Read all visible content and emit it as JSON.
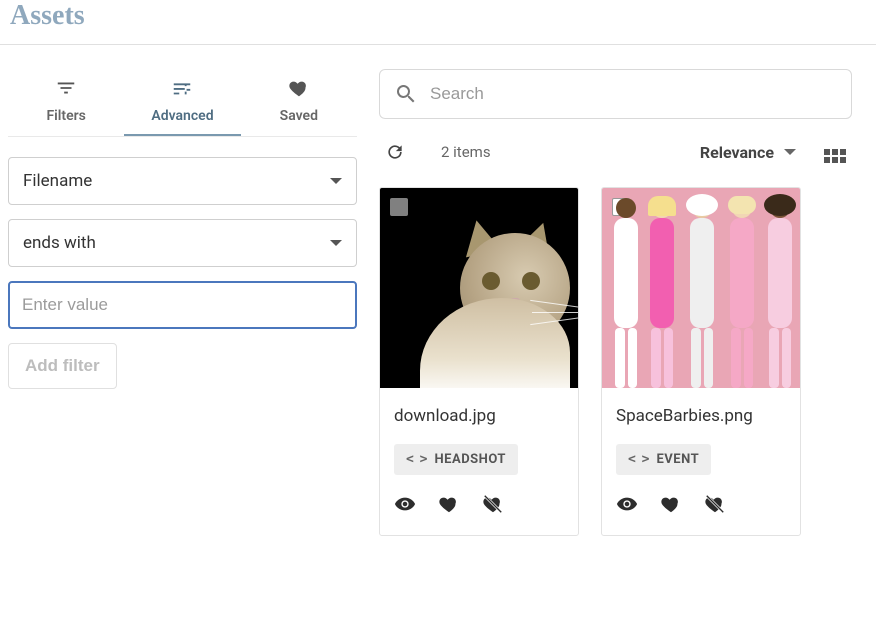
{
  "header": {
    "title": "Assets"
  },
  "tabs": {
    "filters": "Filters",
    "advanced": "Advanced",
    "saved": "Saved",
    "active": "advanced"
  },
  "filter_builder": {
    "field_select": "Filename",
    "operator_select": "ends with",
    "value_placeholder": "Enter value",
    "add_filter_label": "Add filter"
  },
  "search": {
    "placeholder": "Search"
  },
  "toolbar": {
    "count_text": "2 items",
    "sort_label": "Relevance"
  },
  "assets": [
    {
      "filename": "download.jpg",
      "tag": "HEADSHOT",
      "thumb": "cat"
    },
    {
      "filename": "SpaceBarbies.png",
      "tag": "EVENT",
      "thumb": "dolls"
    }
  ]
}
